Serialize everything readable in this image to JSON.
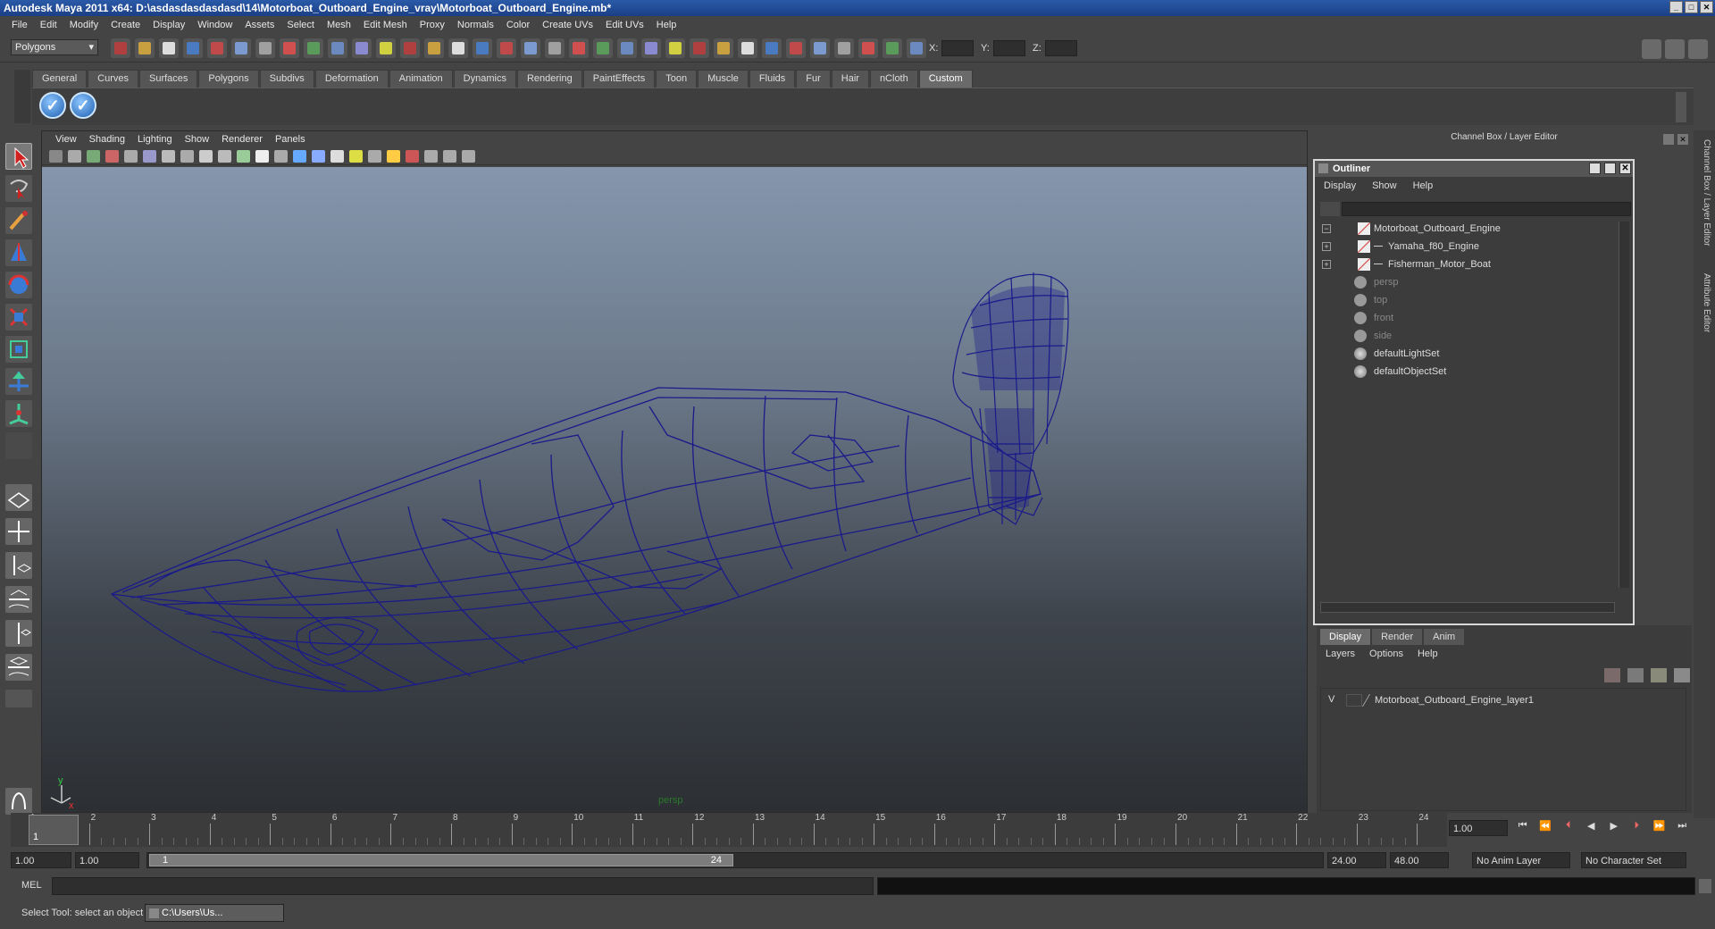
{
  "window": {
    "title": "Autodesk Maya 2011 x64: D:\\asdasdasdasdasd\\14\\Motorboat_Outboard_Engine_vray\\Motorboat_Outboard_Engine.mb*"
  },
  "menus": [
    "File",
    "Edit",
    "Modify",
    "Create",
    "Display",
    "Window",
    "Assets",
    "Select",
    "Mesh",
    "Edit Mesh",
    "Proxy",
    "Normals",
    "Color",
    "Create UVs",
    "Edit UVs",
    "Help"
  ],
  "status": {
    "mode": "Polygons",
    "x_label": "X:",
    "y_label": "Y:",
    "z_label": "Z:"
  },
  "shelf": {
    "tabs": [
      "General",
      "Curves",
      "Surfaces",
      "Polygons",
      "Subdivs",
      "Deformation",
      "Animation",
      "Dynamics",
      "Rendering",
      "PaintEffects",
      "Toon",
      "Muscle",
      "Fluids",
      "Fur",
      "Hair",
      "nCloth",
      "Custom"
    ],
    "active": "Custom"
  },
  "viewport": {
    "menus": [
      "View",
      "Shading",
      "Lighting",
      "Show",
      "Renderer",
      "Panels"
    ],
    "camera_label": "persp",
    "axis_y": "y",
    "axis_x": "x"
  },
  "channel_box": {
    "title": "Channel Box / Layer Editor"
  },
  "outliner": {
    "title": "Outliner",
    "menus": [
      "Display",
      "Show",
      "Help"
    ],
    "items": [
      {
        "label": "Motorboat_Outboard_Engine",
        "expander": "−",
        "dim": false
      },
      {
        "label": "Yamaha_f80_Engine",
        "expander": "+",
        "dim": false
      },
      {
        "label": "Fisherman_Motor_Boat",
        "expander": "+",
        "dim": false
      },
      {
        "label": "persp",
        "expander": "",
        "dim": true
      },
      {
        "label": "top",
        "expander": "",
        "dim": true
      },
      {
        "label": "front",
        "expander": "",
        "dim": true
      },
      {
        "label": "side",
        "expander": "",
        "dim": true
      },
      {
        "label": "defaultLightSet",
        "expander": "",
        "dim": false
      },
      {
        "label": "defaultObjectSet",
        "expander": "",
        "dim": false
      }
    ]
  },
  "layer_editor": {
    "tabs": [
      "Display",
      "Render",
      "Anim"
    ],
    "menus": [
      "Layers",
      "Options",
      "Help"
    ],
    "layer": {
      "visibility": "V",
      "name": "Motorboat_Outboard_Engine_layer1"
    }
  },
  "side_tabs": {
    "channel": "Channel Box / Layer Editor",
    "attr": "Attribute Editor"
  },
  "timeline": {
    "ticks": [
      "1",
      "2",
      "3",
      "4",
      "5",
      "6",
      "7",
      "8",
      "9",
      "10",
      "11",
      "12",
      "13",
      "14",
      "15",
      "16",
      "17",
      "18",
      "19",
      "20",
      "21",
      "22",
      "23",
      "24"
    ],
    "current": "1",
    "current_field": "1.00"
  },
  "range": {
    "start": "1.00",
    "playback_start": "1.00",
    "slider_start": "1",
    "slider_end": "24",
    "playback_end": "24.00",
    "end": "48.00",
    "anim_layer": "No Anim Layer",
    "char_set": "No Character Set"
  },
  "cmd": {
    "label": "MEL"
  },
  "help": {
    "text": "Select Tool: select an object",
    "taskbar": "C:\\Users\\Us..."
  }
}
